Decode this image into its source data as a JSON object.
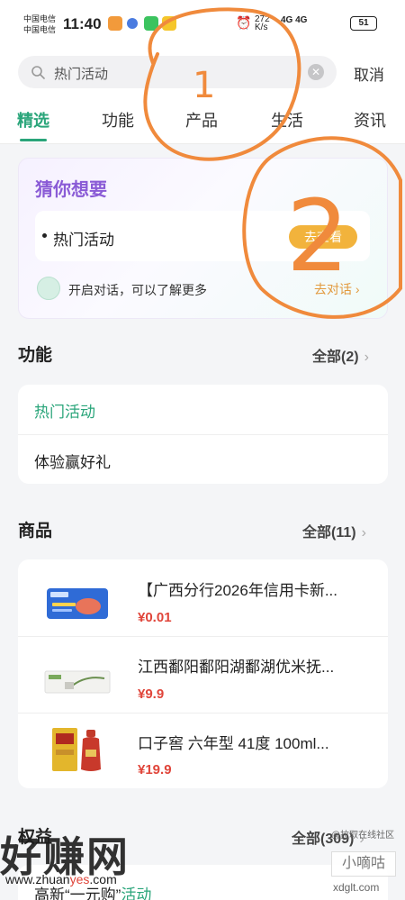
{
  "statusbar": {
    "carrier1": "中国电信",
    "carrier2": "中国电信",
    "time": "11:40",
    "net_speed": "272 K/s",
    "signal": "4G 4G",
    "battery": "51"
  },
  "search": {
    "query": "热门活动",
    "cancel_label": "取消"
  },
  "tabs": [
    "精选",
    "功能",
    "产品",
    "生活",
    "资讯"
  ],
  "guess": {
    "title": "猜你想要",
    "item_label": "热门活动",
    "item_button": "去查看",
    "hint": "开启对话，可以了解更多",
    "hint_link": "去对话"
  },
  "functions": {
    "title": "功能",
    "more": "全部(2)",
    "items": [
      "热门活动",
      "体验赢好礼"
    ]
  },
  "products": {
    "title": "商品",
    "more": "全部(11)",
    "items": [
      {
        "name": "【广西分行2026年信用卡新...",
        "price": "¥0.01"
      },
      {
        "name": "江西鄱阳鄱阳湖鄱湖优米抚...",
        "price": "¥9.9"
      },
      {
        "name": "口子窖 六年型 41度 100ml...",
        "price": "¥19.9"
      }
    ]
  },
  "benefits": {
    "title": "权益",
    "more": "全部(309)",
    "first_item_prefix": "高新“一元购”",
    "first_item_suffix": "活动"
  },
  "annotations": [
    "1",
    "2"
  ],
  "watermark": {
    "logo": "好赚网",
    "url_prefix": "www.zhuan",
    "url_mid": "yes",
    "url_suffix": ".com",
    "tag": "@拉取在线社区",
    "badge": "小嘀咕",
    "site": "xdglt.com"
  },
  "colors": {
    "accent": "#2aa57a",
    "price": "#e0453a",
    "annotation": "#f08a3c",
    "button": "#f2b33c"
  }
}
